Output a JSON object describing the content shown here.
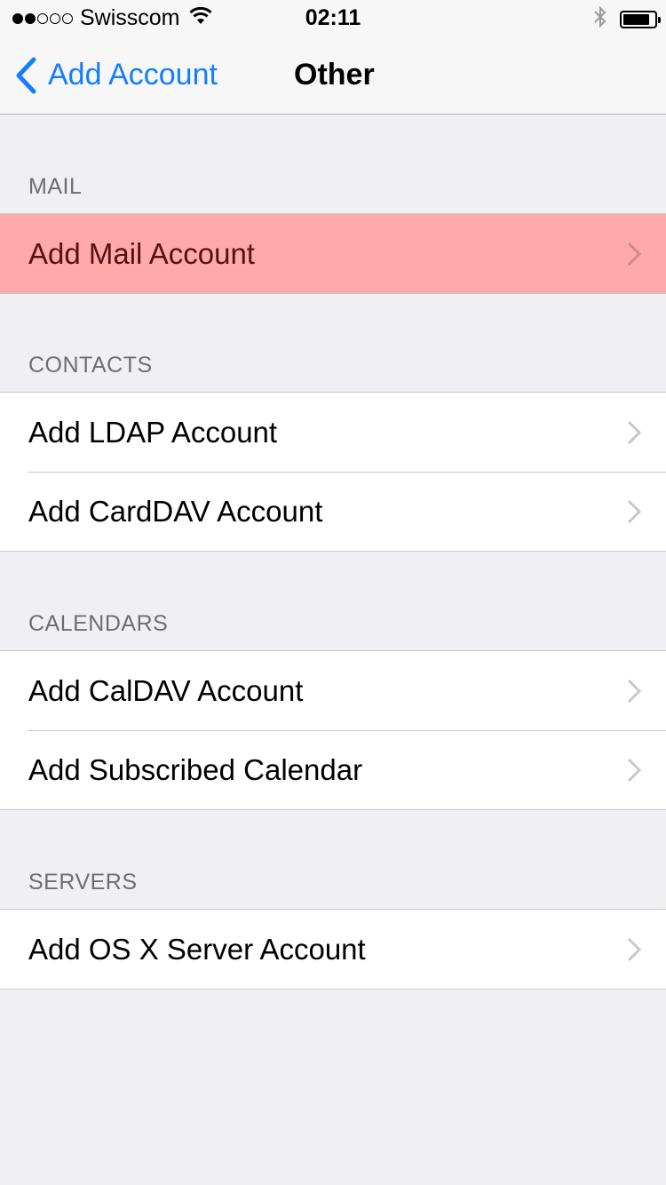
{
  "status_bar": {
    "signal_bars_filled": 2,
    "signal_bars_total": 5,
    "carrier": "Swisscom",
    "time": "02:11",
    "battery_level": 0.85,
    "icons": [
      "wifi-icon",
      "bluetooth-icon",
      "battery-icon"
    ]
  },
  "nav": {
    "back_label": "Add Account",
    "title": "Other"
  },
  "sections": [
    {
      "header": "MAIL",
      "items": [
        {
          "label": "Add Mail Account",
          "highlighted": true
        }
      ]
    },
    {
      "header": "CONTACTS",
      "items": [
        {
          "label": "Add LDAP Account"
        },
        {
          "label": "Add CardDAV Account"
        }
      ]
    },
    {
      "header": "CALENDARS",
      "items": [
        {
          "label": "Add CalDAV Account"
        },
        {
          "label": "Add Subscribed Calendar"
        }
      ]
    },
    {
      "header": "SERVERS",
      "items": [
        {
          "label": "Add OS X Server Account"
        }
      ]
    }
  ],
  "colors": {
    "accent": "#157efb",
    "highlight": "#ffa9aa",
    "background": "#efeff4"
  }
}
